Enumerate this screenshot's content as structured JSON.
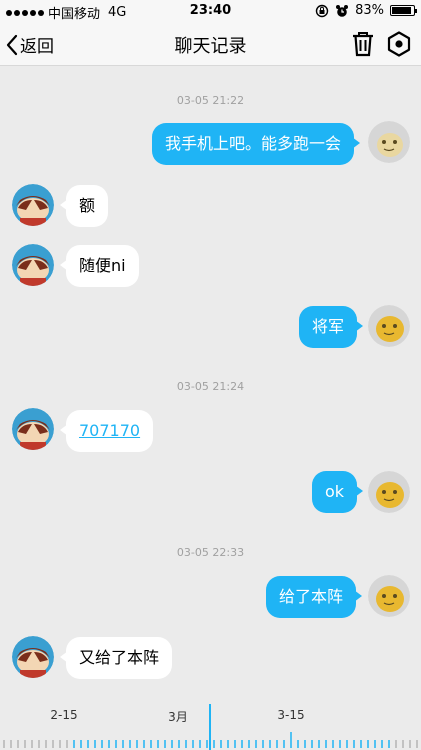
{
  "status": {
    "carrier": "中国移动",
    "network": "4G",
    "time": "23:40",
    "battery": "83%",
    "battery_level": 0.83
  },
  "nav": {
    "back_label": "返回",
    "title": "聊天记录"
  },
  "messages": {
    "t1": "03-05 21:22",
    "m1": "我手机上吧。能多跑一会",
    "m2": "额",
    "m3": "随便ni",
    "m4": "将军",
    "t2": "03-05 21:24",
    "m5": "707170",
    "m6": "ok",
    "t3": "03-05 22:33",
    "m7": "给了本阵",
    "m8": "又给了本阵"
  },
  "timeline": {
    "labels": [
      "2-15",
      "3月",
      "3-15"
    ]
  },
  "colors": {
    "accent": "#1fb4f5",
    "background": "#ebebeb"
  }
}
